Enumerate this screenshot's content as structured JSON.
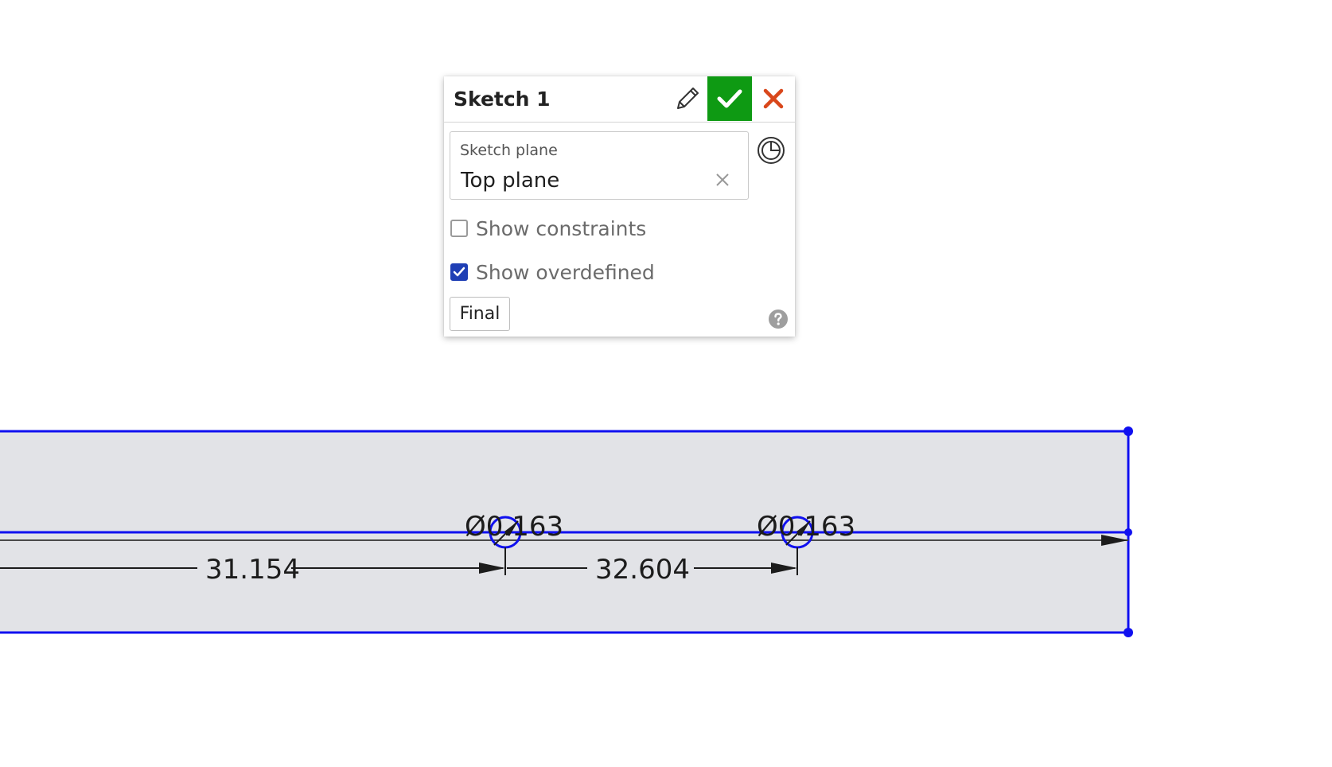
{
  "dialog": {
    "title": "Sketch 1",
    "sketch_plane": {
      "label": "Sketch plane",
      "value": "Top plane"
    },
    "options": [
      {
        "label": "Show constraints",
        "checked": false
      },
      {
        "label": "Show overdefined",
        "checked": true
      }
    ],
    "final_label": "Final",
    "icons": {
      "edit": "pencil-icon",
      "accept": "checkmark-icon",
      "cancel": "close-icon",
      "clear": "clear-x-icon",
      "plane_toggle": "view-normal-icon",
      "help": "help-icon"
    },
    "colors": {
      "accept_bg": "#0e9a13",
      "cancel_x": "#d9471b",
      "checkbox_checked": "#1f3fb5"
    }
  },
  "sketch": {
    "dimensions": [
      {
        "label": "Ø0.163"
      },
      {
        "label": "Ø0.163"
      },
      {
        "label": "31.154"
      },
      {
        "label": "32.604"
      }
    ],
    "colors": {
      "region_fill": "#e2e3e7",
      "sketch_line": "#1010f0",
      "dimension_line": "#1c1c1c"
    }
  }
}
